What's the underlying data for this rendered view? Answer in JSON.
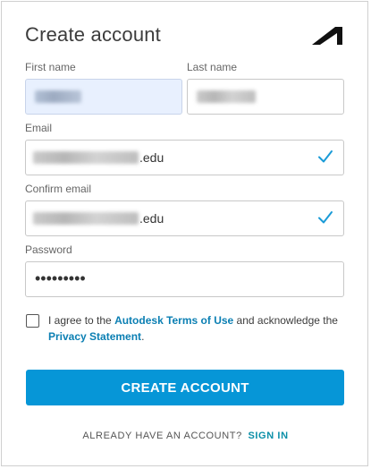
{
  "header": {
    "title": "Create account",
    "logo_icon": "autodesk-logo-icon"
  },
  "form": {
    "first_name": {
      "label": "First name",
      "value": "Richard"
    },
    "last_name": {
      "label": "Last name",
      "value": "Rockledge"
    },
    "email": {
      "label": "Email",
      "value_visible_suffix": ".edu",
      "valid_icon": "check-icon"
    },
    "confirm_email": {
      "label": "Confirm email",
      "value_visible_suffix": ".edu",
      "valid_icon": "check-icon"
    },
    "password": {
      "label": "Password",
      "masked_value": "•••••••••"
    }
  },
  "agreement": {
    "checked": false,
    "text_before": "I agree to the ",
    "terms_link": "Autodesk Terms of Use",
    "text_middle": " and acknowledge the ",
    "privacy_link": "Privacy Statement",
    "text_after": "."
  },
  "actions": {
    "create_label": "CREATE ACCOUNT",
    "have_account_text": "ALREADY HAVE AN ACCOUNT?",
    "sign_in_label": "SIGN IN"
  },
  "colors": {
    "accent": "#0696d7",
    "link": "#0b7fb3",
    "check": "#1a9bd7",
    "autofill_bg": "#e8f0fe"
  }
}
